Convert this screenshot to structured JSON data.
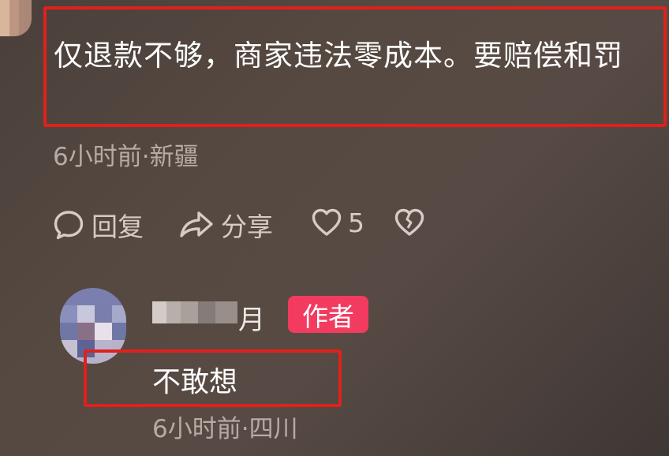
{
  "comment": {
    "text": "仅退款不够，商家违法零成本。要赔偿和罚",
    "meta": "6小时前·新疆",
    "actions": {
      "reply_label": "回复",
      "share_label": "分享",
      "like_count": "5"
    }
  },
  "reply": {
    "author_suffix": "月",
    "author_badge": "作者",
    "text": "不敢想",
    "meta": "6小时前·四川"
  },
  "colors": {
    "highlight": "#e0211b",
    "badge": "#f23b5f"
  }
}
